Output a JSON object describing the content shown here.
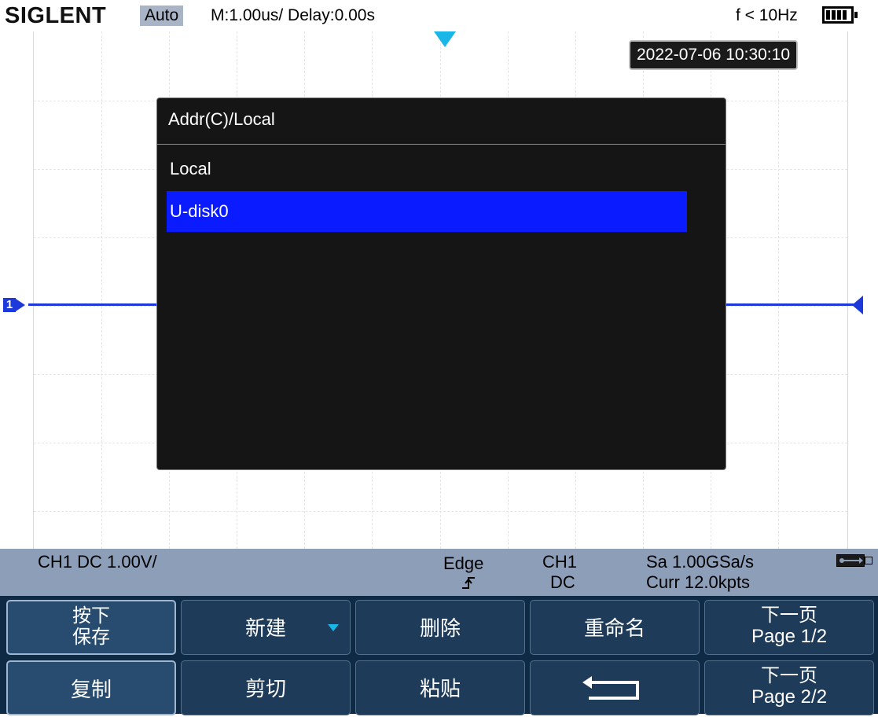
{
  "header": {
    "brand": "SIGLENT",
    "trigger_mode": "Auto",
    "timebase": "M:1.00us/ Delay:0.00s",
    "frequency": "f < 10Hz"
  },
  "datetime": "2022-07-06 10:30:10",
  "channel_marker": "1",
  "dialog": {
    "title": "Addr(C)/Local",
    "items": [
      {
        "label": "Local",
        "selected": false
      },
      {
        "label": "U-disk0",
        "selected": true
      }
    ]
  },
  "status": {
    "channel": "CH1 DC 1.00V/",
    "trigger_type": "Edge",
    "trigger_source": "CH1",
    "trigger_coupling": "DC",
    "sample_rate": "Sa 1.00GSa/s",
    "memory": "Curr 12.0kpts"
  },
  "softkeys": {
    "row1": [
      {
        "top": "按下",
        "bottom": "保存"
      },
      {
        "label": "新建",
        "icon": "chevron-down-icon"
      },
      {
        "label": "删除"
      },
      {
        "label": "重命名"
      },
      {
        "top": "下一页",
        "bottom": "Page 1/2"
      }
    ],
    "row2": [
      {
        "label": "复制"
      },
      {
        "label": "剪切"
      },
      {
        "label": "粘贴"
      },
      {
        "icon": "return-arrow-icon"
      },
      {
        "top": "下一页",
        "bottom": "Page 2/2"
      }
    ]
  },
  "colors": {
    "trace": "#1e39d9",
    "trigger_marker": "#19b6e8",
    "selection": "#0a1bff",
    "status_bar": "#8c9eb8",
    "softkey_bg": "#1e3b5a"
  }
}
